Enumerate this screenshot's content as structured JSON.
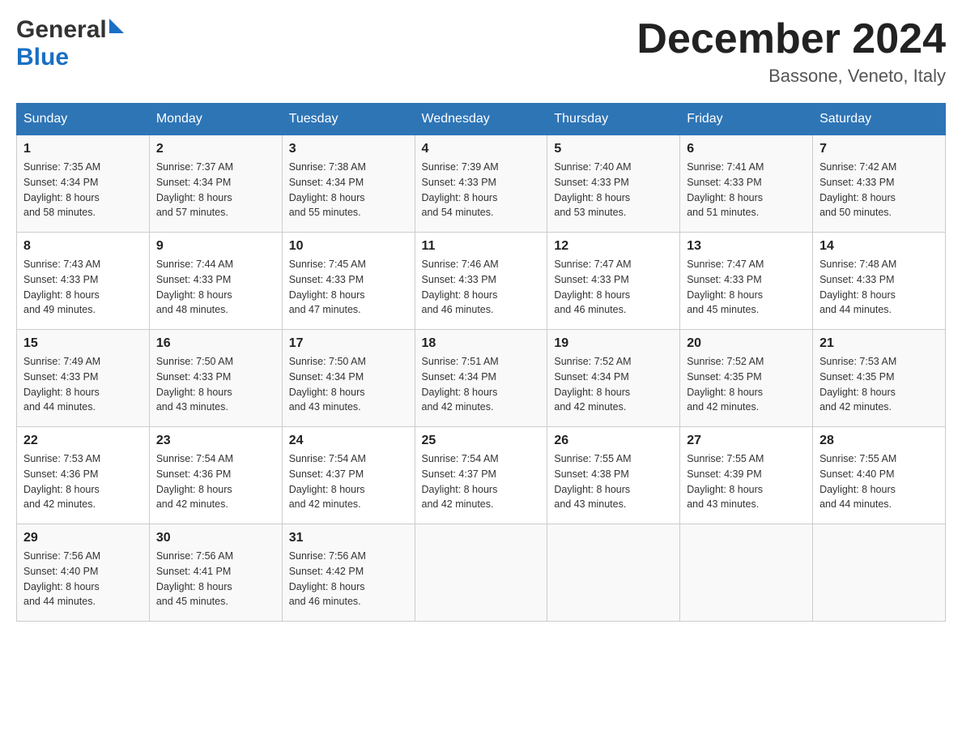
{
  "header": {
    "logo_general": "General",
    "logo_blue": "Blue",
    "month_title": "December 2024",
    "location": "Bassone, Veneto, Italy"
  },
  "days_of_week": [
    "Sunday",
    "Monday",
    "Tuesday",
    "Wednesday",
    "Thursday",
    "Friday",
    "Saturday"
  ],
  "weeks": [
    [
      {
        "day": "1",
        "sunrise": "7:35 AM",
        "sunset": "4:34 PM",
        "daylight": "8 hours and 58 minutes."
      },
      {
        "day": "2",
        "sunrise": "7:37 AM",
        "sunset": "4:34 PM",
        "daylight": "8 hours and 57 minutes."
      },
      {
        "day": "3",
        "sunrise": "7:38 AM",
        "sunset": "4:34 PM",
        "daylight": "8 hours and 55 minutes."
      },
      {
        "day": "4",
        "sunrise": "7:39 AM",
        "sunset": "4:33 PM",
        "daylight": "8 hours and 54 minutes."
      },
      {
        "day": "5",
        "sunrise": "7:40 AM",
        "sunset": "4:33 PM",
        "daylight": "8 hours and 53 minutes."
      },
      {
        "day": "6",
        "sunrise": "7:41 AM",
        "sunset": "4:33 PM",
        "daylight": "8 hours and 51 minutes."
      },
      {
        "day": "7",
        "sunrise": "7:42 AM",
        "sunset": "4:33 PM",
        "daylight": "8 hours and 50 minutes."
      }
    ],
    [
      {
        "day": "8",
        "sunrise": "7:43 AM",
        "sunset": "4:33 PM",
        "daylight": "8 hours and 49 minutes."
      },
      {
        "day": "9",
        "sunrise": "7:44 AM",
        "sunset": "4:33 PM",
        "daylight": "8 hours and 48 minutes."
      },
      {
        "day": "10",
        "sunrise": "7:45 AM",
        "sunset": "4:33 PM",
        "daylight": "8 hours and 47 minutes."
      },
      {
        "day": "11",
        "sunrise": "7:46 AM",
        "sunset": "4:33 PM",
        "daylight": "8 hours and 46 minutes."
      },
      {
        "day": "12",
        "sunrise": "7:47 AM",
        "sunset": "4:33 PM",
        "daylight": "8 hours and 46 minutes."
      },
      {
        "day": "13",
        "sunrise": "7:47 AM",
        "sunset": "4:33 PM",
        "daylight": "8 hours and 45 minutes."
      },
      {
        "day": "14",
        "sunrise": "7:48 AM",
        "sunset": "4:33 PM",
        "daylight": "8 hours and 44 minutes."
      }
    ],
    [
      {
        "day": "15",
        "sunrise": "7:49 AM",
        "sunset": "4:33 PM",
        "daylight": "8 hours and 44 minutes."
      },
      {
        "day": "16",
        "sunrise": "7:50 AM",
        "sunset": "4:33 PM",
        "daylight": "8 hours and 43 minutes."
      },
      {
        "day": "17",
        "sunrise": "7:50 AM",
        "sunset": "4:34 PM",
        "daylight": "8 hours and 43 minutes."
      },
      {
        "day": "18",
        "sunrise": "7:51 AM",
        "sunset": "4:34 PM",
        "daylight": "8 hours and 42 minutes."
      },
      {
        "day": "19",
        "sunrise": "7:52 AM",
        "sunset": "4:34 PM",
        "daylight": "8 hours and 42 minutes."
      },
      {
        "day": "20",
        "sunrise": "7:52 AM",
        "sunset": "4:35 PM",
        "daylight": "8 hours and 42 minutes."
      },
      {
        "day": "21",
        "sunrise": "7:53 AM",
        "sunset": "4:35 PM",
        "daylight": "8 hours and 42 minutes."
      }
    ],
    [
      {
        "day": "22",
        "sunrise": "7:53 AM",
        "sunset": "4:36 PM",
        "daylight": "8 hours and 42 minutes."
      },
      {
        "day": "23",
        "sunrise": "7:54 AM",
        "sunset": "4:36 PM",
        "daylight": "8 hours and 42 minutes."
      },
      {
        "day": "24",
        "sunrise": "7:54 AM",
        "sunset": "4:37 PM",
        "daylight": "8 hours and 42 minutes."
      },
      {
        "day": "25",
        "sunrise": "7:54 AM",
        "sunset": "4:37 PM",
        "daylight": "8 hours and 42 minutes."
      },
      {
        "day": "26",
        "sunrise": "7:55 AM",
        "sunset": "4:38 PM",
        "daylight": "8 hours and 43 minutes."
      },
      {
        "day": "27",
        "sunrise": "7:55 AM",
        "sunset": "4:39 PM",
        "daylight": "8 hours and 43 minutes."
      },
      {
        "day": "28",
        "sunrise": "7:55 AM",
        "sunset": "4:40 PM",
        "daylight": "8 hours and 44 minutes."
      }
    ],
    [
      {
        "day": "29",
        "sunrise": "7:56 AM",
        "sunset": "4:40 PM",
        "daylight": "8 hours and 44 minutes."
      },
      {
        "day": "30",
        "sunrise": "7:56 AM",
        "sunset": "4:41 PM",
        "daylight": "8 hours and 45 minutes."
      },
      {
        "day": "31",
        "sunrise": "7:56 AM",
        "sunset": "4:42 PM",
        "daylight": "8 hours and 46 minutes."
      },
      null,
      null,
      null,
      null
    ]
  ],
  "labels": {
    "sunrise": "Sunrise:",
    "sunset": "Sunset:",
    "daylight": "Daylight:"
  }
}
